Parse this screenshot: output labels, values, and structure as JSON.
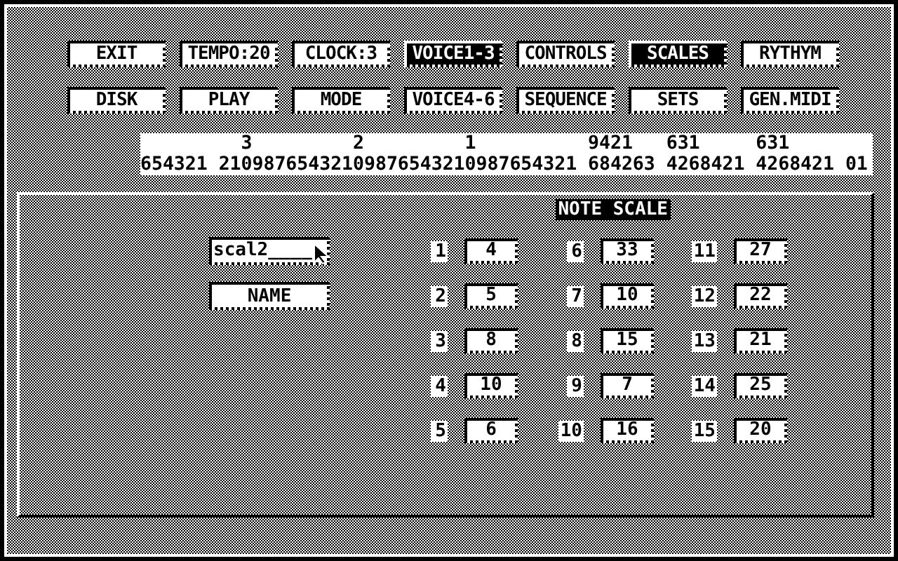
{
  "buttons": [
    [
      {
        "label": "EXIT",
        "selected": false
      },
      {
        "label": "TEMPO:20",
        "selected": false
      },
      {
        "label": "CLOCK:3",
        "selected": false
      },
      {
        "label": "VOICE1-3",
        "selected": true
      },
      {
        "label": "CONTROLS",
        "selected": false
      },
      {
        "label": "SCALES",
        "selected": true
      },
      {
        "label": "RYTHYM",
        "selected": false
      }
    ],
    [
      {
        "label": "DISK",
        "selected": false
      },
      {
        "label": "PLAY",
        "selected": false
      },
      {
        "label": "MODE",
        "selected": false
      },
      {
        "label": "VOICE4-6",
        "selected": false
      },
      {
        "label": "SEQUENCE",
        "selected": false
      },
      {
        "label": "SETS",
        "selected": false
      },
      {
        "label": "GEN.MIDI",
        "selected": false
      }
    ]
  ],
  "bit_ruler": {
    "line_1": "         3         2         1          9421   631     631",
    "line_2": "654321 21098765432109876543210987654321 684263 4268421 4268421 01"
  },
  "panel": {
    "title": "NOTE SCALE",
    "name_field": {
      "value": "scal2____"
    },
    "name_button": "NAME",
    "notes": [
      {
        "number": "1",
        "value": "4"
      },
      {
        "number": "2",
        "value": "5"
      },
      {
        "number": "3",
        "value": "8"
      },
      {
        "number": "4",
        "value": "10"
      },
      {
        "number": "5",
        "value": "6"
      },
      {
        "number": "6",
        "value": "33"
      },
      {
        "number": "7",
        "value": "10"
      },
      {
        "number": "8",
        "value": "15"
      },
      {
        "number": "9",
        "value": "7"
      },
      {
        "number": "10",
        "value": "16"
      },
      {
        "number": "11",
        "value": "27"
      },
      {
        "number": "12",
        "value": "22"
      },
      {
        "number": "13",
        "value": "21"
      },
      {
        "number": "14",
        "value": "25"
      },
      {
        "number": "15",
        "value": "20"
      }
    ]
  }
}
